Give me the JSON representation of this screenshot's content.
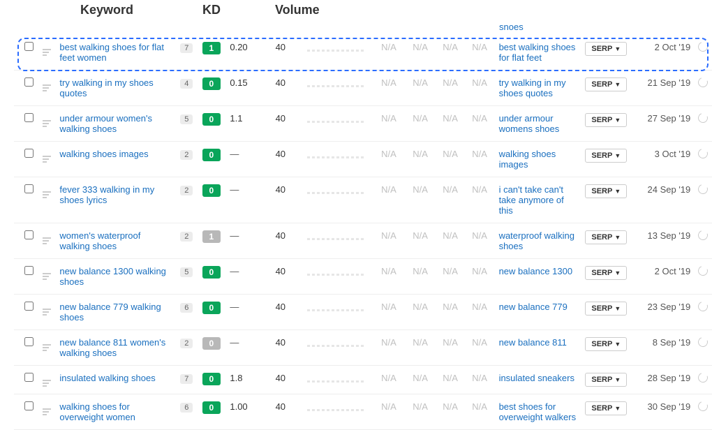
{
  "headers": {
    "keyword": "Keyword",
    "kd": "KD",
    "volume": "Volume"
  },
  "partial_top_link": "snoes",
  "serp_label": "SERP",
  "na": "N/A",
  "dash": "—",
  "rows": [
    {
      "keyword": "best walking shoes for flat feet women",
      "num": "7",
      "kd": "1",
      "kd_color": "green",
      "cpc": "0.20",
      "volume": "40",
      "parent": "best walking shoes for flat feet",
      "date": "2 Oct '19"
    },
    {
      "keyword": "try walking in my shoes quotes",
      "num": "4",
      "kd": "0",
      "kd_color": "green",
      "cpc": "0.15",
      "volume": "40",
      "parent": "try walking in my shoes quotes",
      "date": "21 Sep '19"
    },
    {
      "keyword": "under armour women's walking shoes",
      "num": "5",
      "kd": "0",
      "kd_color": "green",
      "cpc": "1.1",
      "volume": "40",
      "parent": "under armour womens shoes",
      "date": "27 Sep '19"
    },
    {
      "keyword": "walking shoes images",
      "num": "2",
      "kd": "0",
      "kd_color": "green",
      "cpc": "",
      "volume": "40",
      "parent": "walking shoes images",
      "date": "3 Oct '19"
    },
    {
      "keyword": "fever 333 walking in my shoes lyrics",
      "num": "2",
      "kd": "0",
      "kd_color": "green",
      "cpc": "",
      "volume": "40",
      "parent": "i can't take can't take anymore of this",
      "date": "24 Sep '19"
    },
    {
      "keyword": "women's waterproof walking shoes",
      "num": "2",
      "kd": "1",
      "kd_color": "grey",
      "cpc": "",
      "volume": "40",
      "parent": "waterproof walking shoes",
      "date": "13 Sep '19"
    },
    {
      "keyword": "new balance 1300 walking shoes",
      "num": "5",
      "kd": "0",
      "kd_color": "green",
      "cpc": "",
      "volume": "40",
      "parent": "new balance 1300",
      "date": "2 Oct '19"
    },
    {
      "keyword": "new balance 779 walking shoes",
      "num": "6",
      "kd": "0",
      "kd_color": "green",
      "cpc": "",
      "volume": "40",
      "parent": "new balance 779",
      "date": "23 Sep '19"
    },
    {
      "keyword": "new balance 811 women's walking shoes",
      "num": "2",
      "kd": "0",
      "kd_color": "grey",
      "cpc": "",
      "volume": "40",
      "parent": "new balance 811",
      "date": "8 Sep '19"
    },
    {
      "keyword": "insulated walking shoes",
      "num": "7",
      "kd": "0",
      "kd_color": "green",
      "cpc": "1.8",
      "volume": "40",
      "parent": "insulated sneakers",
      "date": "28 Sep '19"
    },
    {
      "keyword": "walking shoes for overweight women",
      "num": "6",
      "kd": "0",
      "kd_color": "green",
      "cpc": "1.00",
      "volume": "40",
      "parent": "best shoes for overweight walkers",
      "date": "30 Sep '19"
    }
  ]
}
